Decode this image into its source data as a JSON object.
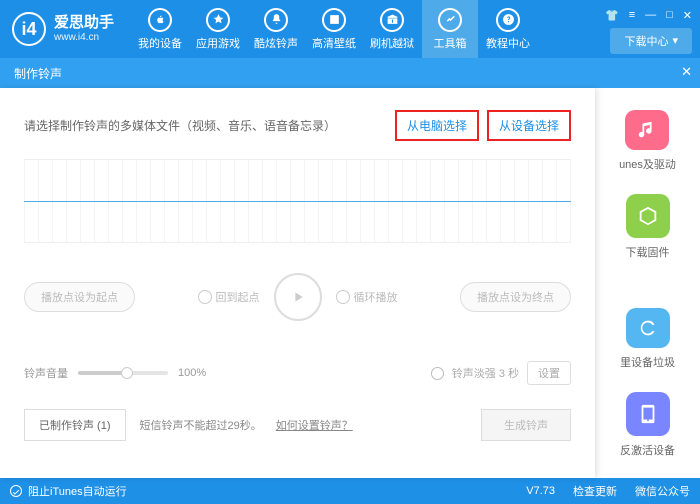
{
  "app": {
    "name": "爱思助手",
    "url": "www.i4.cn"
  },
  "nav": [
    {
      "label": "我的设备",
      "icon": "apple"
    },
    {
      "label": "应用游戏",
      "icon": "appstore"
    },
    {
      "label": "酷炫铃声",
      "icon": "bell"
    },
    {
      "label": "高清壁纸",
      "icon": "image"
    },
    {
      "label": "刷机越狱",
      "icon": "box"
    },
    {
      "label": "工具箱",
      "icon": "tools"
    },
    {
      "label": "教程中心",
      "icon": "help"
    }
  ],
  "nav_active_index": 5,
  "download_center": "下载中心",
  "tab": {
    "title": "制作铃声"
  },
  "modal": {
    "prompt": "请选择制作铃声的多媒体文件（视频、音乐、语音备忘录）",
    "btn_from_computer": "从电脑选择",
    "btn_from_device": "从设备选择",
    "set_start": "播放点设为起点",
    "back_start": "回到起点",
    "loop_play": "循环播放",
    "set_end": "播放点设为终点",
    "volume_label": "铃声音量",
    "volume_value": "100%",
    "fade_label": "铃声淡强 3 秒",
    "fade_set": "设置",
    "made_label": "已制作铃声 (1)",
    "sms_note": "短信铃声不能超过29秒。",
    "how_link": "如何设置铃声？",
    "generate": "生成铃声"
  },
  "side": [
    {
      "label": "unes及驱动",
      "color": "#ff6b8a",
      "icon": "music"
    },
    {
      "label": "下载固件",
      "color": "#8ed04b",
      "icon": "cube"
    },
    {
      "label": "里设备垃圾",
      "color": "#55b7f2",
      "icon": "refresh"
    },
    {
      "label": "反激活设备",
      "color": "#7a86ff",
      "icon": "phone"
    }
  ],
  "status": {
    "itunes": "阻止iTunes自动运行",
    "version": "V7.73",
    "check_update": "检查更新",
    "wechat": "微信公众号"
  }
}
